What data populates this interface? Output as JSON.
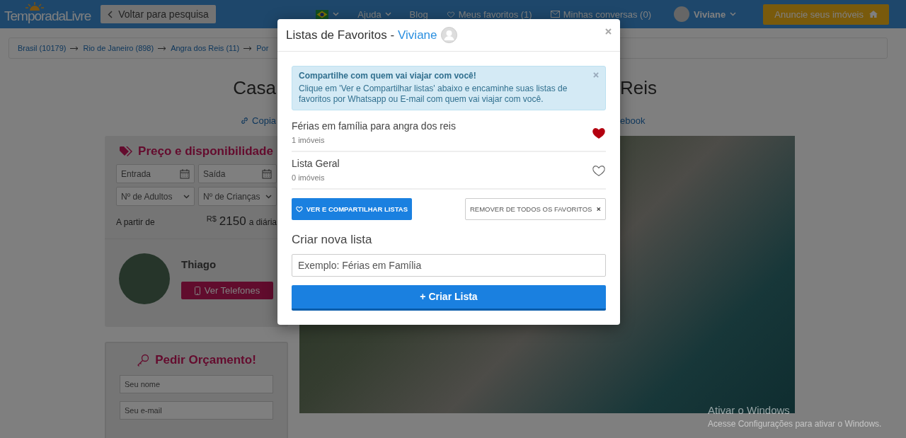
{
  "header": {
    "logo": "TemporadaLivre",
    "back_button": "Voltar para pesquisa",
    "nav": [
      {
        "label": "Ajuda",
        "kind": "dropdown"
      },
      {
        "label": "Blog",
        "kind": "link"
      },
      {
        "label": "Meus favoritos (1)",
        "kind": "favorites"
      },
      {
        "label": "Minhas conversas (0)",
        "kind": "messages"
      }
    ],
    "user": "Viviane",
    "cta": "Anuncie seus imóveis"
  },
  "breadcrumb": [
    "Brasil (10179)",
    "Rio de Janeiro (898)",
    "Angra dos Reis (11)",
    "Por"
  ],
  "title_parts": [
    "Casa",
    "Reis"
  ],
  "share_links": [
    "Copia",
    "ebook"
  ],
  "booking": {
    "heading": "Preço e disponibilidade",
    "checkin_placeholder": "Entrada",
    "checkout_placeholder": "Saída",
    "adults": "Nº de Adultos",
    "children": "Nº de Crianças",
    "from_label": "A partir de",
    "currency": "R$",
    "price": "2150",
    "unit": "a diária"
  },
  "host": {
    "name": "Thiago",
    "phones_button": "Ver Telefones"
  },
  "quote": {
    "heading": "Pedir Orçamento!",
    "fields": [
      {
        "placeholder": "Seu nome"
      },
      {
        "placeholder": "Seu e-mail"
      }
    ]
  },
  "modal": {
    "title": "Listas de Favoritos -",
    "user": "Viviane",
    "alert": {
      "heading": "Compartilhe com quem vai viajar com você!",
      "text": "Clique em 'Ver e Compartilhar listas' abaixo e encaminhe suas listas de favoritos por Whatsapp ou E-mail com quem vai viajar com você."
    },
    "lists": [
      {
        "name": "Férias em família para angra dos reis",
        "count": "1 imóveis",
        "favorited": true
      },
      {
        "name": "Lista Geral",
        "count": "0 imóveis",
        "favorited": false
      }
    ],
    "share_button": "VER E COMPARTILHAR LISTAS",
    "remove_button": "REMOVER DE TODOS OS FAVORITOS",
    "new_list_heading": "Criar nova lista",
    "new_list_placeholder": "Exemplo: Férias em Família",
    "create_button": "+ Criar Lista"
  },
  "os_notice": {
    "title": "Ativar o Windows",
    "text": "Acesse Configurações para ativar o Windows."
  }
}
